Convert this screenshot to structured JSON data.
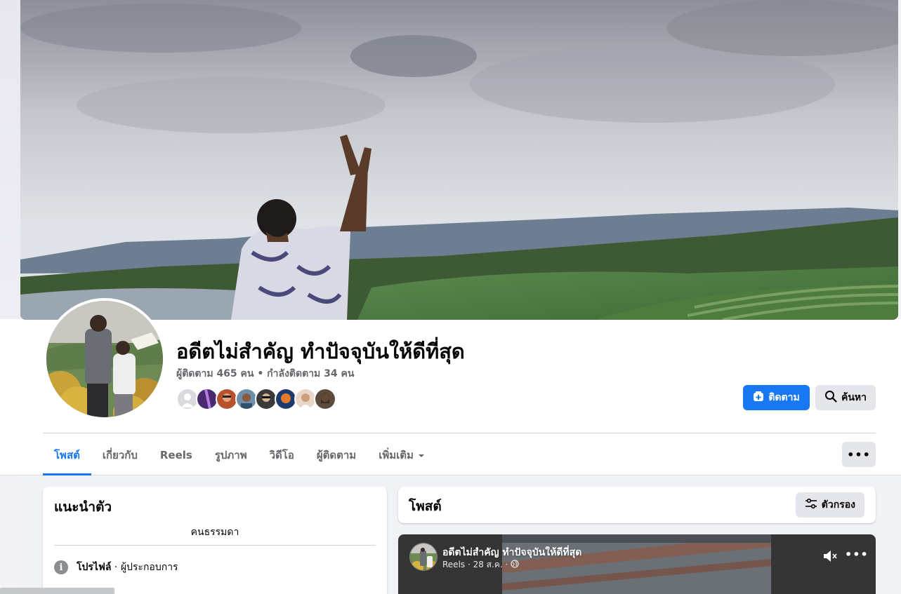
{
  "profile": {
    "name": "อดีตไม่สำคัญ ทำปัจจุบันให้ดีที่สุด",
    "stats": "ผู้ติดตาม 465 คน • กำลังติดตาม 34 คน"
  },
  "actions": {
    "follow_label": "ติดตาม",
    "search_label": "ค้นหา",
    "more_label": "•••"
  },
  "tabs": [
    {
      "label": "โพสต์",
      "active": true
    },
    {
      "label": "เกี่ยวกับ"
    },
    {
      "label": "Reels"
    },
    {
      "label": "รูปภาพ"
    },
    {
      "label": "วิดีโอ"
    },
    {
      "label": "ผู้ติดตาม"
    },
    {
      "label": "เพิ่มเติม"
    }
  ],
  "intro": {
    "title": "แนะนำตัว",
    "bio": "คนธรรมดา",
    "profile_label": "โปรไฟล์",
    "profile_sub": " · ผู้ประกอบการ"
  },
  "posts": {
    "title": "โพสต์",
    "filter_label": "ตัวกรอง"
  },
  "reel": {
    "author": "อดีตไม่สำคัญ ทำปัจจุบันให้ดีที่สุด",
    "meta": "Reels · 28 ส.ค. ·"
  },
  "icons": {
    "follow": "add-friend-icon",
    "search": "search-icon",
    "filter": "sliders-icon",
    "info": "info-icon",
    "mute": "muted-speaker-icon",
    "globe": "globe-icon"
  },
  "colors": {
    "accent": "#1877f2",
    "secondary_button": "#e4e6eb",
    "muted_text": "#65676b",
    "page_bg": "#f0f2f5"
  }
}
